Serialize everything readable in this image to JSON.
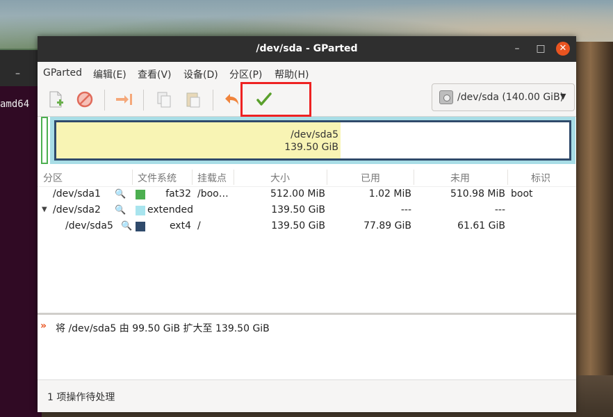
{
  "terminal": {
    "dash": "–",
    "text": "amd64"
  },
  "window": {
    "title": "/dev/sda - GParted",
    "controls": {
      "minimize": "–",
      "maximize": "□",
      "close": "✕"
    }
  },
  "menu": [
    "GParted",
    "编辑(E)",
    "查看(V)",
    "设备(D)",
    "分区(P)",
    "帮助(H)"
  ],
  "toolbar": {
    "icons": [
      "new-partition",
      "delete",
      "resize-move",
      "copy",
      "paste",
      "undo",
      "apply"
    ]
  },
  "device": {
    "label": "/dev/sda (140.00 GiB)"
  },
  "graph": {
    "name": "/dev/sda5",
    "size": "139.50 GiB",
    "used_fraction": 0.554
  },
  "columns": [
    "分区",
    "文件系统",
    "挂载点",
    "大小",
    "已用",
    "未用",
    "标识"
  ],
  "rows": [
    {
      "partition": "/dev/sda1",
      "fs": "fat32",
      "mount": "/boo…",
      "size": "512.00 MiB",
      "used": "1.02 MiB",
      "unused": "510.98 MiB",
      "flags": "boot",
      "color": "#4caf50"
    },
    {
      "partition": "/dev/sda2",
      "fs": "extended",
      "mount": "",
      "size": "139.50 GiB",
      "used": "---",
      "unused": "---",
      "flags": "",
      "color": "#a8e4ee"
    },
    {
      "partition": "/dev/sda5",
      "fs": "ext4",
      "mount": "/",
      "size": "139.50 GiB",
      "used": "77.89 GiB",
      "unused": "61.61 GiB",
      "flags": "",
      "color": "#2f4a6b"
    }
  ],
  "operations": [
    "将 /dev/sda5 由 99.50 GiB 扩大至 139.50 GiB"
  ],
  "status": "1 项操作待处理"
}
